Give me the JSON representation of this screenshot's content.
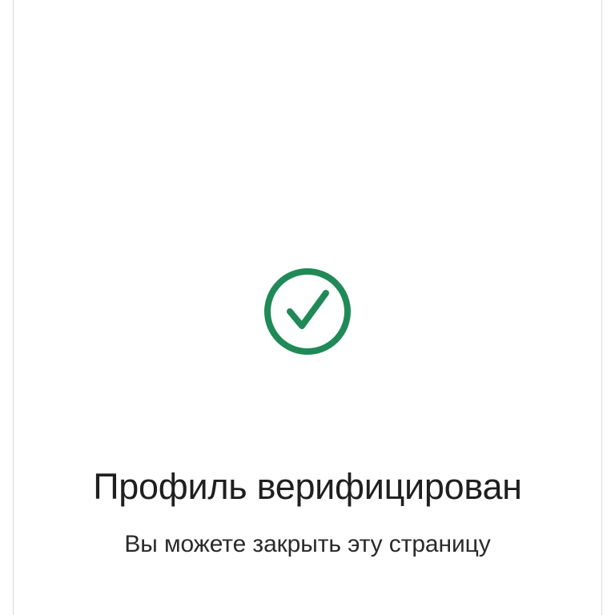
{
  "status": {
    "icon": "check-circle-icon",
    "accent_color": "#1f8a58",
    "title": "Профиль верифицирован",
    "subtitle": "Вы можете закрыть эту страницу"
  },
  "colors": {
    "background": "#ffffff",
    "text_primary": "#1f1f1f",
    "text_secondary": "#2a2a2a",
    "frame_border": "#d9d9d9"
  }
}
